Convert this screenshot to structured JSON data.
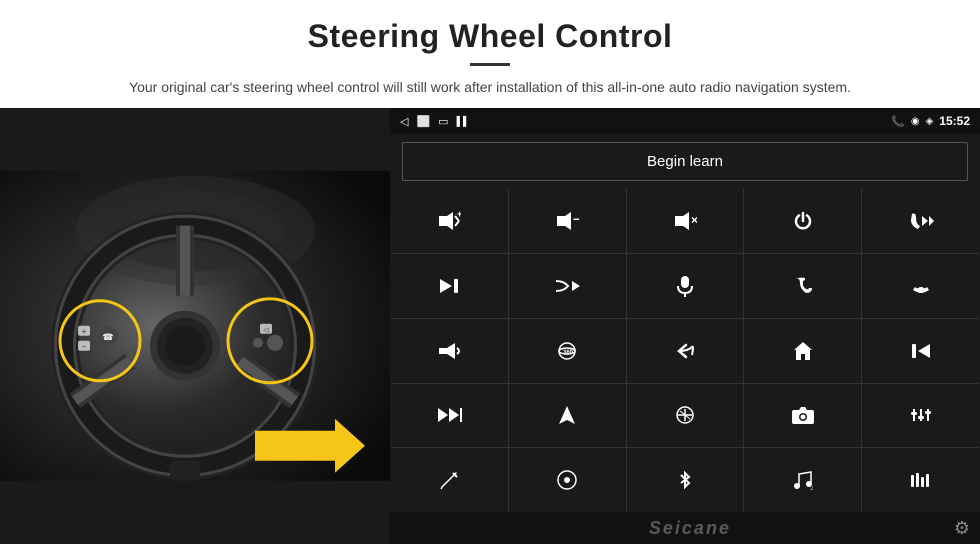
{
  "header": {
    "title": "Steering Wheel Control",
    "subtitle": "Your original car's steering wheel control will still work after installation of this all-in-one auto radio navigation system."
  },
  "status_bar": {
    "time": "15:52",
    "icons": [
      "back",
      "home",
      "square",
      "signal"
    ]
  },
  "begin_learn_btn": "Begin learn",
  "brand": "Seicane",
  "grid_icons": [
    {
      "id": "vol-up",
      "symbol": "🔊+",
      "row": 1,
      "col": 1
    },
    {
      "id": "vol-down",
      "symbol": "🔉−",
      "row": 1,
      "col": 2
    },
    {
      "id": "vol-mute",
      "symbol": "🔇×",
      "row": 1,
      "col": 3
    },
    {
      "id": "power",
      "symbol": "⏻",
      "row": 1,
      "col": 4
    },
    {
      "id": "phone-prev",
      "symbol": "📞⏮",
      "row": 1,
      "col": 5
    },
    {
      "id": "skip-next",
      "symbol": "⏭",
      "row": 2,
      "col": 1
    },
    {
      "id": "shuffle-fwd",
      "symbol": "⤧⏭",
      "row": 2,
      "col": 2
    },
    {
      "id": "mic",
      "symbol": "🎤",
      "row": 2,
      "col": 3
    },
    {
      "id": "phone",
      "symbol": "📞",
      "row": 2,
      "col": 4
    },
    {
      "id": "hangup",
      "symbol": "📵",
      "row": 2,
      "col": 5
    },
    {
      "id": "horn",
      "symbol": "📢",
      "row": 3,
      "col": 1
    },
    {
      "id": "360",
      "symbol": "⟳360",
      "row": 3,
      "col": 2
    },
    {
      "id": "back-arrow",
      "symbol": "↩",
      "row": 3,
      "col": 3
    },
    {
      "id": "home",
      "symbol": "⌂",
      "row": 3,
      "col": 4
    },
    {
      "id": "skip-back",
      "symbol": "⏮⏮",
      "row": 3,
      "col": 5
    },
    {
      "id": "fast-fwd2",
      "symbol": "⏩",
      "row": 4,
      "col": 1
    },
    {
      "id": "nav",
      "symbol": "▲",
      "row": 4,
      "col": 2
    },
    {
      "id": "eq",
      "symbol": "⇋",
      "row": 4,
      "col": 3
    },
    {
      "id": "camera",
      "symbol": "📷",
      "row": 4,
      "col": 4
    },
    {
      "id": "sliders",
      "symbol": "🎚",
      "row": 4,
      "col": 5
    },
    {
      "id": "pen",
      "symbol": "✏",
      "row": 5,
      "col": 1
    },
    {
      "id": "circle-dot",
      "symbol": "◎",
      "row": 5,
      "col": 2
    },
    {
      "id": "bluetooth",
      "symbol": "Ƀ",
      "row": 5,
      "col": 3
    },
    {
      "id": "music-note",
      "symbol": "♫",
      "row": 5,
      "col": 4
    },
    {
      "id": "equalizer-bars",
      "symbol": "▌▌▌",
      "row": 5,
      "col": 5
    }
  ]
}
